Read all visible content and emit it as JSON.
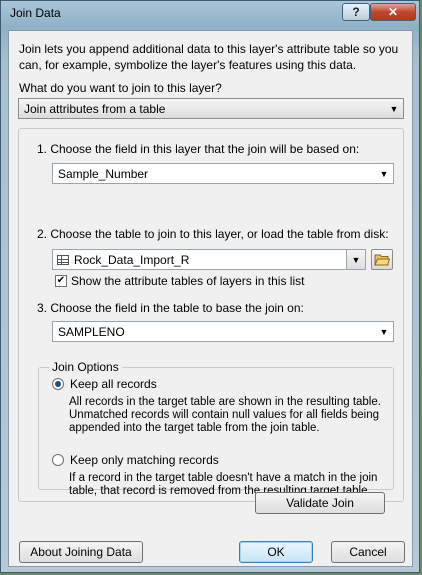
{
  "window": {
    "title": "Join Data",
    "help_label": "?",
    "close_label": "✕"
  },
  "intro": "Join lets you append additional data to this layer's attribute table so you can, for example, symbolize the layer's features using this data.",
  "join_type": {
    "question": "What do you want to join to this layer?",
    "selected": "Join attributes from a table"
  },
  "step1": {
    "label": "1.  Choose the field in this layer that the join will be based on:",
    "selected": "Sample_Number"
  },
  "step2": {
    "label": "2.  Choose the table to join to this layer, or load the table from disk:",
    "selected": "Rock_Data_Import_R",
    "checkbox_label": "Show the attribute tables of layers in this list",
    "checkbox_checked": true
  },
  "step3": {
    "label": "3.  Choose the field in the table to base the join on:",
    "selected": "SAMPLENO"
  },
  "join_options": {
    "title": "Join Options",
    "keep_all_label": "Keep all records",
    "keep_all_desc": "All records in the target table are shown in the resulting table. Unmatched records will contain null values for all fields being appended into the target table from the join table.",
    "keep_matching_label": "Keep only matching records",
    "keep_matching_desc": "If a record in the target table doesn't have a match in the join table, that record is removed from the resulting target table.",
    "selected": "keep_all"
  },
  "buttons": {
    "validate": "Validate Join",
    "about": "About Joining Data",
    "ok": "OK",
    "cancel": "Cancel"
  },
  "icons": {
    "table": "table-icon",
    "folder": "open-folder-icon",
    "dropdown": "chevron-down-icon"
  }
}
